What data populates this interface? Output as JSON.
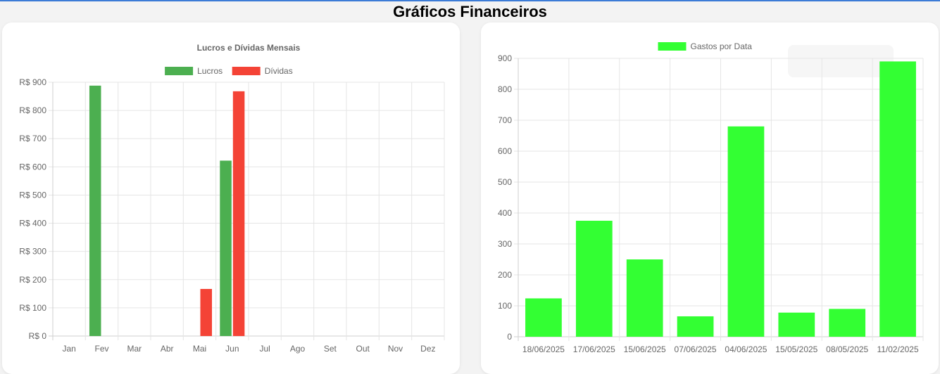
{
  "page": {
    "title": "Gráficos Financeiros"
  },
  "colors": {
    "lucros": "#4caf50",
    "dividas": "#f44336",
    "gastos": "#33ff33",
    "grid": "#e5e5e5",
    "tick": "#666666"
  },
  "chart_data": [
    {
      "type": "bar",
      "title": "Lucros e Dívidas Mensais",
      "categories": [
        "Jan",
        "Fev",
        "Mar",
        "Abr",
        "Mai",
        "Jun",
        "Jul",
        "Ago",
        "Set",
        "Out",
        "Nov",
        "Dez"
      ],
      "series": [
        {
          "name": "Lucros",
          "values": [
            0,
            888,
            0,
            0,
            0,
            622,
            0,
            0,
            0,
            0,
            0,
            0
          ]
        },
        {
          "name": "Dívidas",
          "values": [
            0,
            0,
            0,
            0,
            167,
            868,
            0,
            0,
            0,
            0,
            0,
            0
          ]
        }
      ],
      "ylim": [
        0,
        900
      ],
      "yticks": [
        "R$ 0",
        "R$ 100",
        "R$ 200",
        "R$ 300",
        "R$ 400",
        "R$ 500",
        "R$ 600",
        "R$ 700",
        "R$ 800",
        "R$ 900"
      ],
      "legend": "top",
      "grid": true
    },
    {
      "type": "bar",
      "categories": [
        "18/06/2025",
        "17/06/2025",
        "15/06/2025",
        "07/06/2025",
        "04/06/2025",
        "15/05/2025",
        "08/05/2025",
        "11/02/2025"
      ],
      "series": [
        {
          "name": "Gastos por Data",
          "values": [
            124,
            375,
            250,
            66,
            680,
            78,
            90,
            890
          ]
        }
      ],
      "ylim": [
        0,
        900
      ],
      "yticks": [
        "0",
        "100",
        "200",
        "300",
        "400",
        "500",
        "600",
        "700",
        "800",
        "900"
      ],
      "legend": "top",
      "grid": true
    }
  ]
}
